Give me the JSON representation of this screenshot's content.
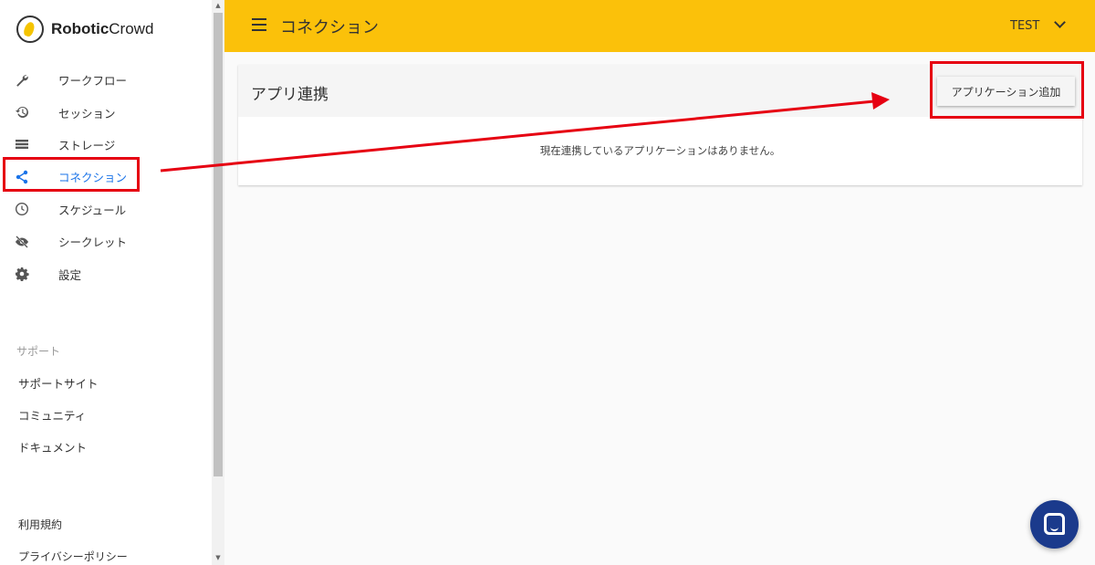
{
  "app": {
    "brand_bold": "Robotic",
    "brand_light": "Crowd"
  },
  "sidebar": {
    "items": [
      {
        "label": "ワークフロー",
        "icon": "wrench-icon"
      },
      {
        "label": "セッション",
        "icon": "history-icon"
      },
      {
        "label": "ストレージ",
        "icon": "list-icon"
      },
      {
        "label": "コネクション",
        "icon": "share-icon",
        "active": true
      },
      {
        "label": "スケジュール",
        "icon": "clock-icon"
      },
      {
        "label": "シークレット",
        "icon": "eye-off-icon"
      },
      {
        "label": "設定",
        "icon": "gear-icon"
      }
    ],
    "support_title": "サポート",
    "support_links": [
      "サポートサイト",
      "コミュニティ",
      "ドキュメント"
    ],
    "terms": "利用規約",
    "privacy": "プライバシーポリシー"
  },
  "header": {
    "title": "コネクション",
    "user": "TEST"
  },
  "card": {
    "title": "アプリ連携",
    "add_button": "アプリケーション追加",
    "empty_message": "現在連携しているアプリケーションはありません。"
  },
  "colors": {
    "header_bg": "#fbc10a",
    "active": "#1a73e8",
    "annotation": "#e60012",
    "chat": "#1b3a8c"
  }
}
